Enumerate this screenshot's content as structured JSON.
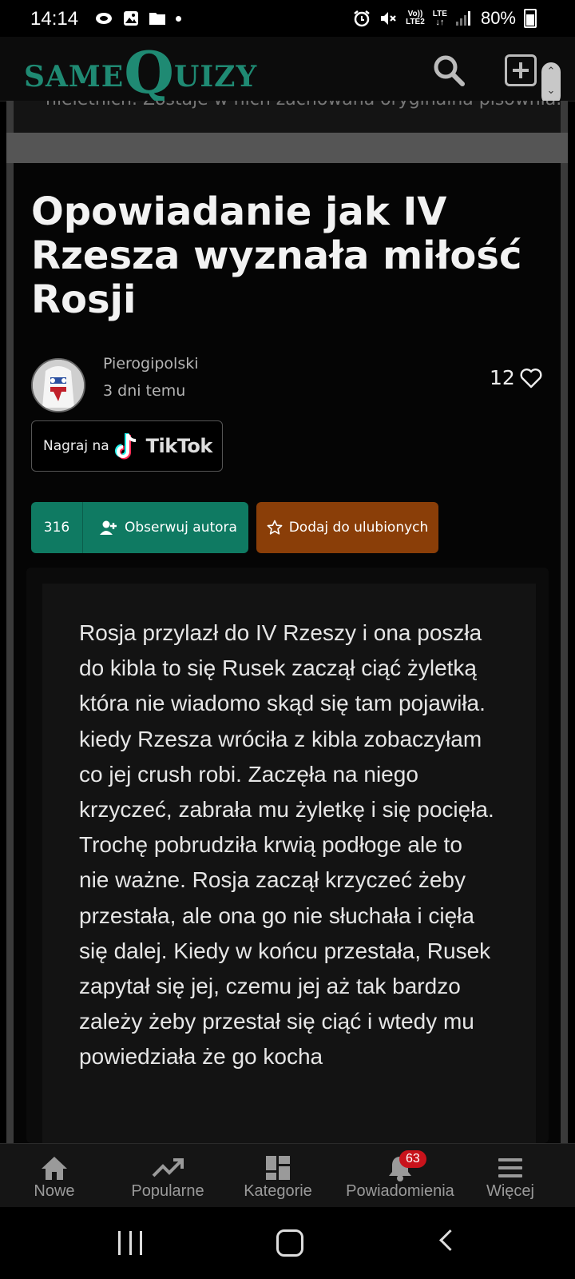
{
  "status_bar": {
    "time": "14:14",
    "volte": "Vo))",
    "lte2": "LTE2",
    "lte": "LTE",
    "battery": "80%"
  },
  "header": {
    "logo_part1": "SAME",
    "logo_part2": "Q",
    "logo_part3": "UIZY"
  },
  "previous_card_text": "nieletnich. Zostaje w nich zachowana oryginalna pisownia.",
  "post": {
    "title": "Opowiadanie jak IV Rzesza wyznała miłość Rosji",
    "author": "Pierogipolski",
    "date": "3 dni temu",
    "likes": "12",
    "tiktok_prefix": "Nagraj na",
    "tiktok_brand": "TikTok",
    "follow_count": "316",
    "follow_label": "Obserwuj autora",
    "favorite_label": "Dodaj do ulubionych",
    "story": "Rosja przylazł do IV Rzeszy i ona poszła do kibla to się Rusek zaczął ciąć żyletką która nie wiadomo skąd się tam pojawiła. kiedy Rzesza wróciła z kibla zobaczyłam co jej crush robi. Zaczęła na niego krzyczeć, zabrała mu żyletkę i się pocięła. Trochę pobrudziła krwią podłoge ale to nie ważne. Rosja zaczął krzyczeć żeby przestała, ale ona go nie słuchała i cięła się dalej. Kiedy w końcu przestała, Rusek zapytał się jej, czemu jej aż tak bardzo zależy żeby przestał się ciąć i wtedy mu powiedziała że go kocha"
  },
  "bottom_nav": {
    "items": [
      {
        "label": "Nowe",
        "icon": "home-icon"
      },
      {
        "label": "Popularne",
        "icon": "trending-icon"
      },
      {
        "label": "Kategorie",
        "icon": "grid-icon"
      },
      {
        "label": "Powiadomienia",
        "icon": "bell-icon",
        "badge": "63"
      },
      {
        "label": "Więcej",
        "icon": "menu-icon"
      }
    ]
  },
  "colors": {
    "brand": "#1f8a73",
    "follow": "#0f7a62",
    "favorite": "#8a3e08",
    "badge": "#c8131b"
  }
}
